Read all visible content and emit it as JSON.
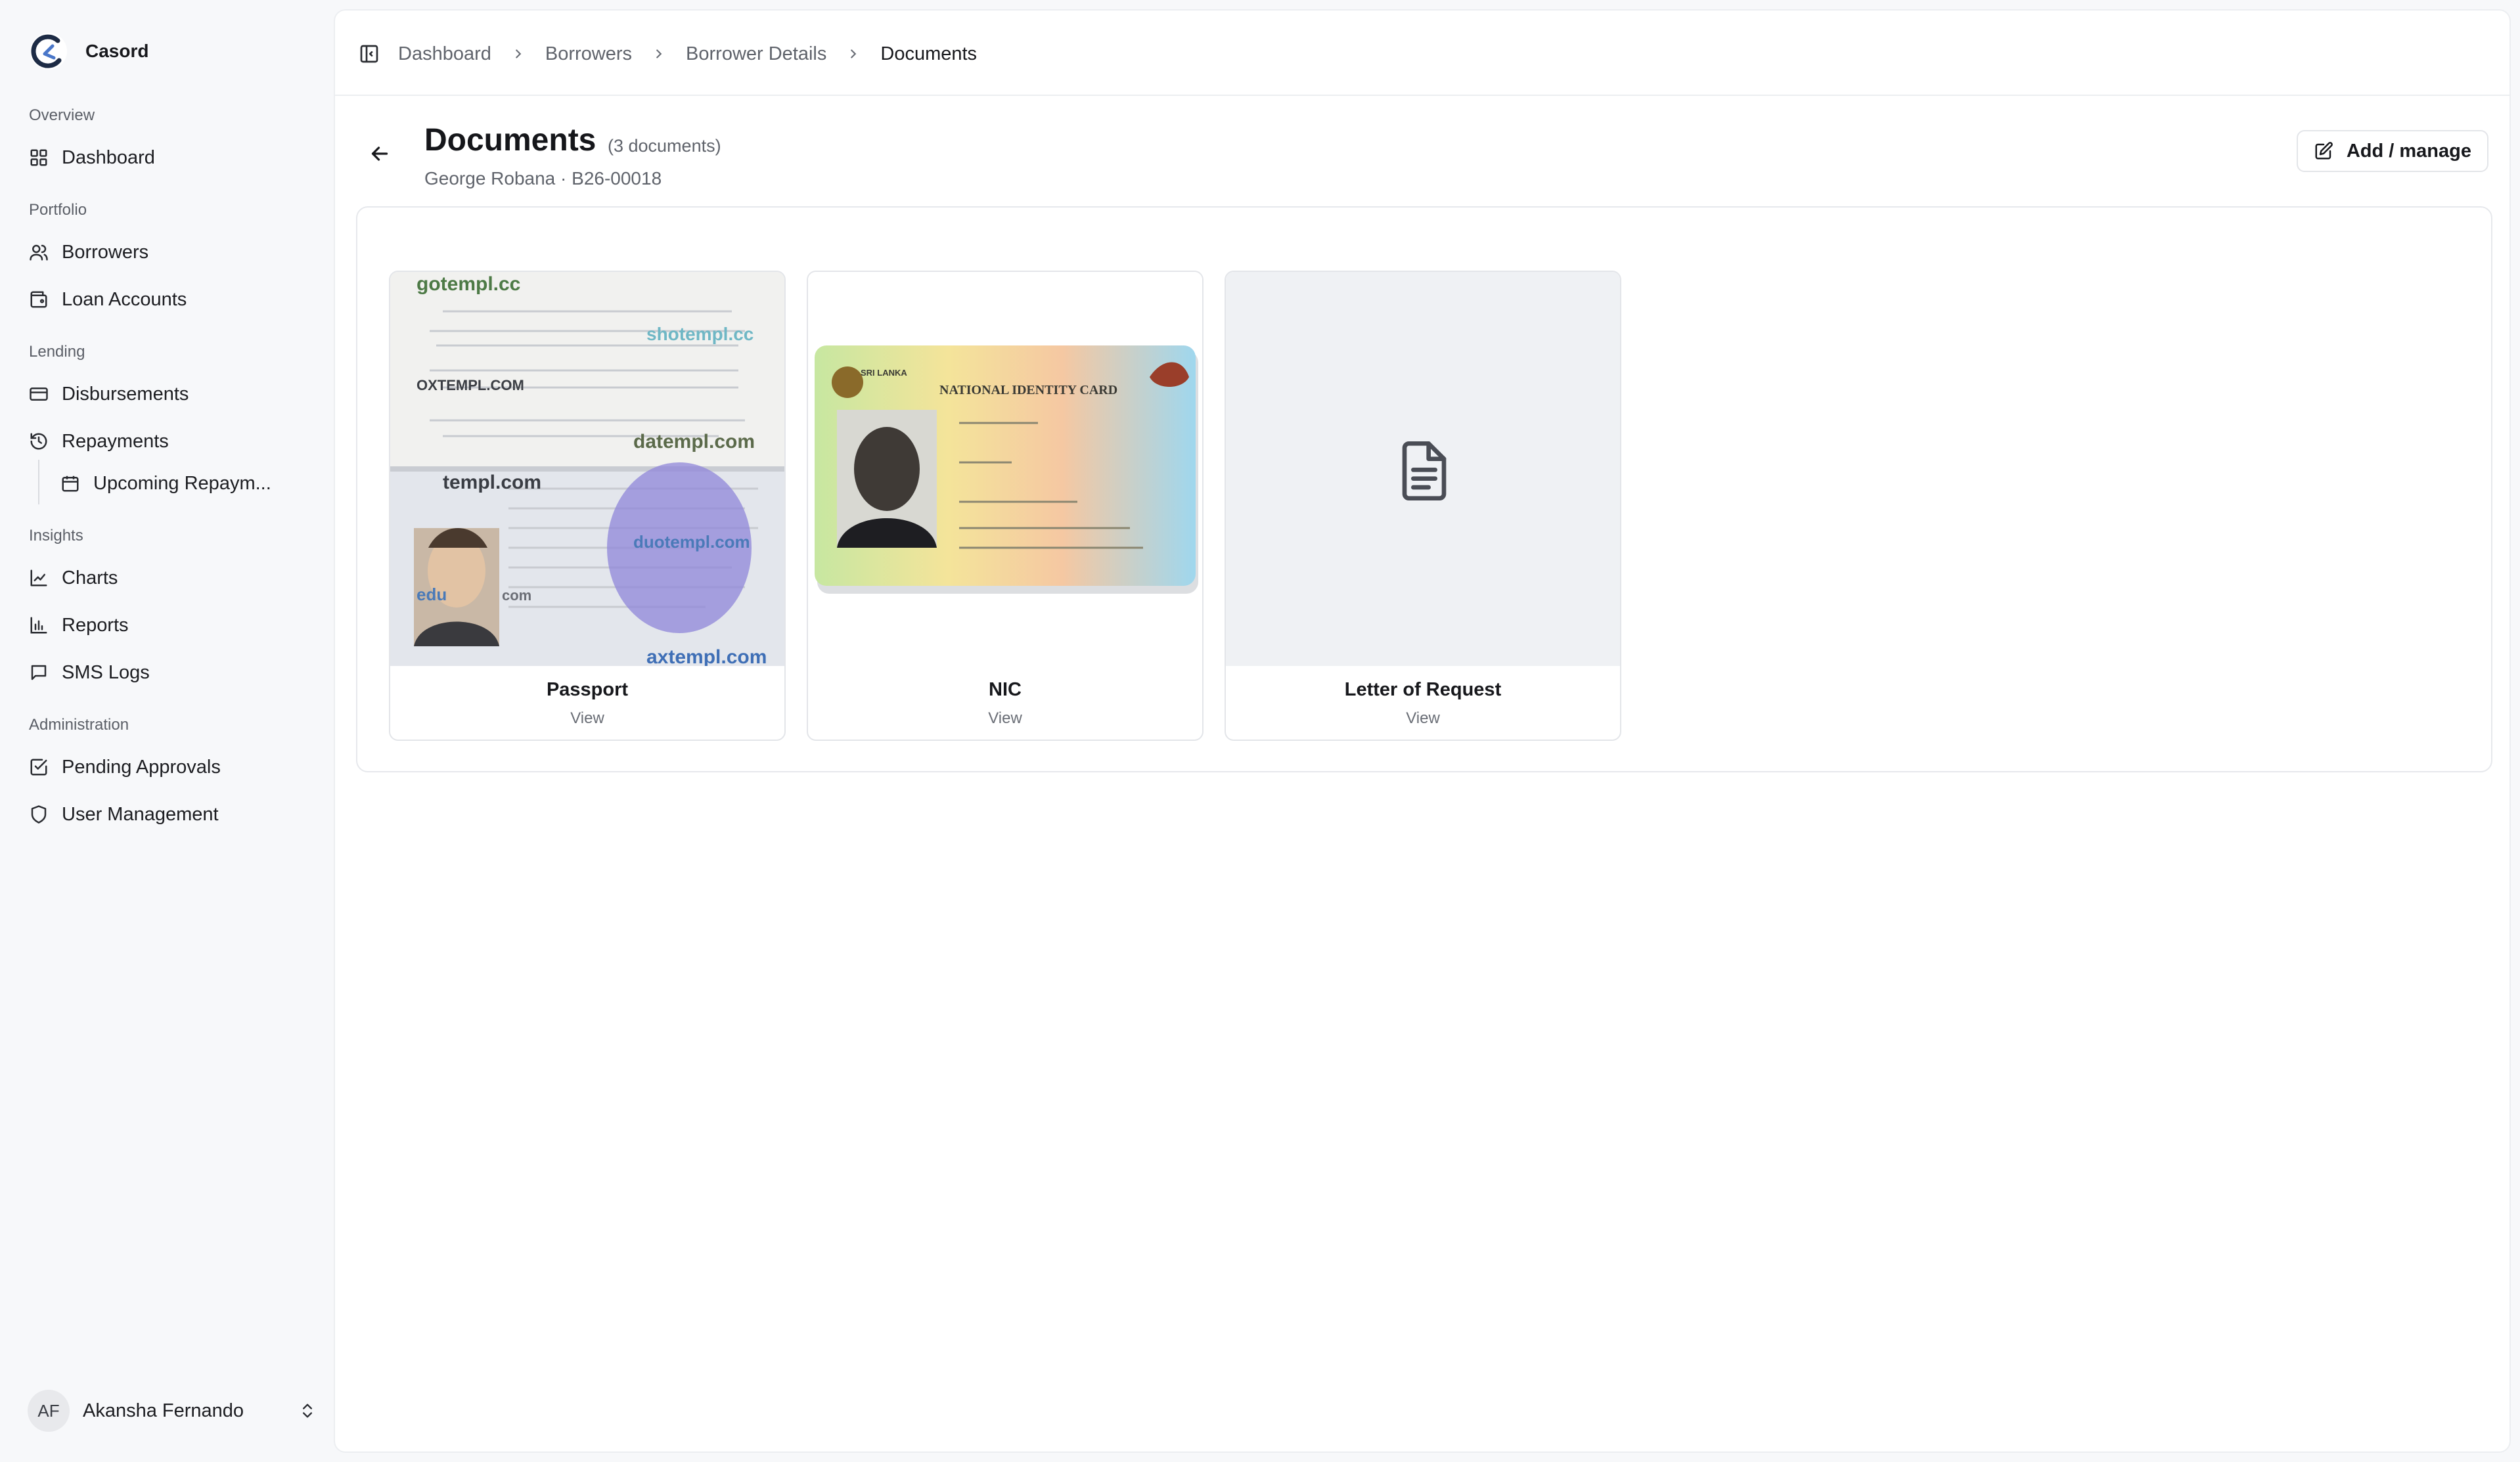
{
  "brand": {
    "name": "Casord"
  },
  "sidebar": {
    "groups": [
      {
        "label": "Overview",
        "items": [
          {
            "label": "Dashboard",
            "icon": "grid-icon"
          }
        ]
      },
      {
        "label": "Portfolio",
        "items": [
          {
            "label": "Borrowers",
            "icon": "users-icon"
          },
          {
            "label": "Loan Accounts",
            "icon": "wallet-icon"
          }
        ]
      },
      {
        "label": "Lending",
        "items": [
          {
            "label": "Disbursements",
            "icon": "card-icon"
          },
          {
            "label": "Repayments",
            "icon": "history-icon"
          },
          {
            "label": "Upcoming Repaym...",
            "icon": "calendar-icon"
          }
        ]
      },
      {
        "label": "Insights",
        "items": [
          {
            "label": "Charts",
            "icon": "line-chart-icon"
          },
          {
            "label": "Reports",
            "icon": "bar-chart-icon"
          },
          {
            "label": "SMS Logs",
            "icon": "message-icon"
          }
        ]
      },
      {
        "label": "Administration",
        "items": [
          {
            "label": "Pending Approvals",
            "icon": "check-square-icon"
          },
          {
            "label": "User Management",
            "icon": "shield-icon"
          }
        ]
      }
    ]
  },
  "user": {
    "initials": "AF",
    "name": "Akansha Fernando"
  },
  "breadcrumb": [
    "Dashboard",
    "Borrowers",
    "Borrower Details",
    "Documents"
  ],
  "page": {
    "title": "Documents",
    "count": "(3 documents)",
    "subtitle": "George Robana · B26-00018",
    "add_button": "Add / manage"
  },
  "documents": [
    {
      "name": "Passport",
      "action": "View",
      "watermarks": [
        "gotempl.cc",
        "shotempl.cc",
        "OXTEMPL.COM",
        "datempl.com",
        "templ.com",
        "edu",
        "com",
        "axtempl.com",
        "duotempl.com"
      ]
    },
    {
      "name": "NIC",
      "action": "View",
      "card_title": "NATIONAL IDENTITY CARD",
      "card_country": "SRI LANKA"
    },
    {
      "name": "Letter of Request",
      "action": "View",
      "icon": "file-text-icon"
    }
  ],
  "colors": {
    "accent": "#17181c",
    "muted": "#5f636b",
    "border": "#e3e5e9"
  }
}
